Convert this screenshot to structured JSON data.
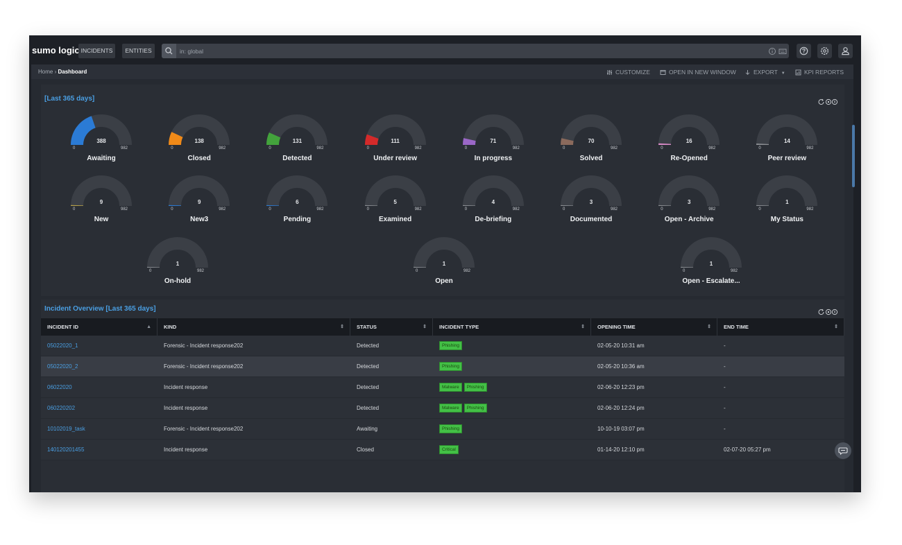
{
  "app": {
    "logo": "sumo logic",
    "nav": [
      "INCIDENTS",
      "ENTITIES"
    ],
    "search_value": "in: global"
  },
  "breadcrumb": {
    "home": "Home",
    "current": "Dashboard"
  },
  "actions": {
    "customize": "CUSTOMIZE",
    "open_new": "OPEN IN NEW WINDOW",
    "export": "EXPORT",
    "kpi": "KPI REPORTS"
  },
  "gauges_panel": {
    "title": "[Last 365 days]",
    "min": "0",
    "max": "982",
    "max_value": 982,
    "items": [
      {
        "label": "Awaiting",
        "value": 388,
        "value_text": "388",
        "color": "#2b7bd5"
      },
      {
        "label": "Closed",
        "value": 138,
        "value_text": "138",
        "color": "#f08a18"
      },
      {
        "label": "Detected",
        "value": 131,
        "value_text": "131",
        "color": "#43a33c"
      },
      {
        "label": "Under review",
        "value": 111,
        "value_text": "111",
        "color": "#d42a2a"
      },
      {
        "label": "In progress",
        "value": 71,
        "value_text": "71",
        "color": "#9a67c7"
      },
      {
        "label": "Solved",
        "value": 70,
        "value_text": "70",
        "color": "#8b6a5c"
      },
      {
        "label": "Re-Opened",
        "value": 16,
        "value_text": "16",
        "color": "#d88ac7"
      },
      {
        "label": "Peer review",
        "value": 14,
        "value_text": "14",
        "color": "#8a8d92"
      },
      {
        "label": "New",
        "value": 9,
        "value_text": "9",
        "color": "#b8a24a"
      },
      {
        "label": "New3",
        "value": 9,
        "value_text": "9",
        "color": "#2b7bd5"
      },
      {
        "label": "Pending",
        "value": 6,
        "value_text": "6",
        "color": "#2b7bd5"
      },
      {
        "label": "Examined",
        "value": 5,
        "value_text": "5",
        "color": "#8a8d92"
      },
      {
        "label": "De-briefing",
        "value": 4,
        "value_text": "4",
        "color": "#8a8d92"
      },
      {
        "label": "Documented",
        "value": 3,
        "value_text": "3",
        "color": "#8a8d92"
      },
      {
        "label": "Open - Archive",
        "value": 3,
        "value_text": "3",
        "color": "#8a8d92"
      },
      {
        "label": "My Status",
        "value": 1,
        "value_text": "1",
        "color": "#8a8d92"
      },
      {
        "label": "On-hold",
        "value": 1,
        "value_text": "1",
        "color": "#8a8d92"
      },
      {
        "label": "Open",
        "value": 1,
        "value_text": "1",
        "color": "#8a8d92"
      },
      {
        "label": "Open - Escalate...",
        "value": 1,
        "value_text": "1",
        "color": "#8a8d92"
      }
    ]
  },
  "table_panel": {
    "title": "Incident Overview [Last 365 days]",
    "columns": [
      "INCIDENT ID",
      "KIND",
      "STATUS",
      "INCIDENT TYPE",
      "OPENING TIME",
      "END TIME"
    ],
    "rows": [
      {
        "id": "05022020_1",
        "kind": "Forensic - Incident response202",
        "status": "Detected",
        "types": [
          "Phishing"
        ],
        "opening": "02-05-20 10:31 am",
        "end": "-"
      },
      {
        "id": "05022020_2",
        "kind": "Forensic - Incident response202",
        "status": "Detected",
        "types": [
          "Phishing"
        ],
        "opening": "02-05-20 10:36 am",
        "end": "-"
      },
      {
        "id": "06022020",
        "kind": "Incident response",
        "status": "Detected",
        "types": [
          "Malware",
          "Phishing"
        ],
        "opening": "02-06-20 12:23 pm",
        "end": "-"
      },
      {
        "id": "060220202",
        "kind": "Incident response",
        "status": "Detected",
        "types": [
          "Malware",
          "Phishing"
        ],
        "opening": "02-06-20 12:24 pm",
        "end": "-"
      },
      {
        "id": "10102019_task",
        "kind": "Forensic - Incident response202",
        "status": "Awaiting",
        "types": [
          "Phishing"
        ],
        "opening": "10-10-19 03:07 pm",
        "end": "-"
      },
      {
        "id": "140120201455",
        "kind": "Incident response",
        "status": "Closed",
        "types": [
          "Critical"
        ],
        "opening": "01-14-20 12:10 pm",
        "end": "02-07-20 05:27 pm"
      }
    ]
  },
  "colors": {
    "accent": "#4a9fe3",
    "background": "#1d2026",
    "tag": "#43c046"
  }
}
